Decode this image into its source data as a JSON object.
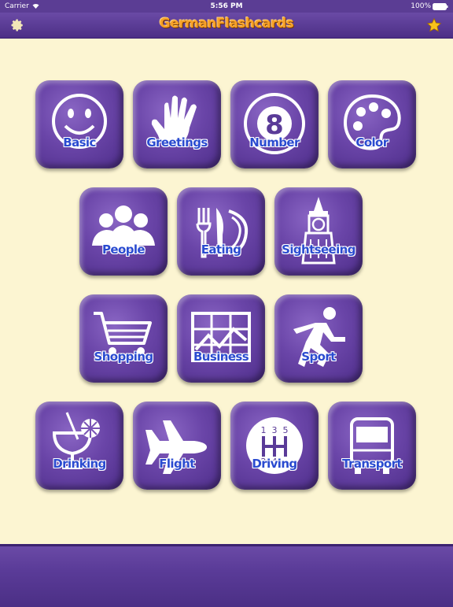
{
  "status_bar": {
    "carrier": "Carrier",
    "time": "5:56 PM",
    "battery": "100%"
  },
  "nav_bar": {
    "title": "GermanFlashcards",
    "settings_icon": "gear-icon",
    "favorites_icon": "star-icon"
  },
  "categories": [
    {
      "label": "Basic",
      "icon": "smiley-icon"
    },
    {
      "label": "Greetings",
      "icon": "hand-icon"
    },
    {
      "label": "Number",
      "icon": "number-eight-icon"
    },
    {
      "label": "Color",
      "icon": "palette-icon"
    },
    {
      "label": "People",
      "icon": "people-icon"
    },
    {
      "label": "Eating",
      "icon": "fork-knife-plate-icon"
    },
    {
      "label": "Sightseeing",
      "icon": "clock-tower-icon"
    },
    {
      "label": "Shopping",
      "icon": "shopping-cart-icon"
    },
    {
      "label": "Business",
      "icon": "chart-grid-icon"
    },
    {
      "label": "Sport",
      "icon": "soccer-player-icon"
    },
    {
      "label": "Drinking",
      "icon": "cocktail-icon"
    },
    {
      "label": "Flight",
      "icon": "airplane-icon"
    },
    {
      "label": "Driving",
      "icon": "gear-shift-icon"
    },
    {
      "label": "Transport",
      "icon": "bus-icon"
    }
  ],
  "colors": {
    "background": "#fcf5d2",
    "tile": "#6a45a8",
    "label": "#2a4bd0",
    "title": "#f7a128"
  }
}
